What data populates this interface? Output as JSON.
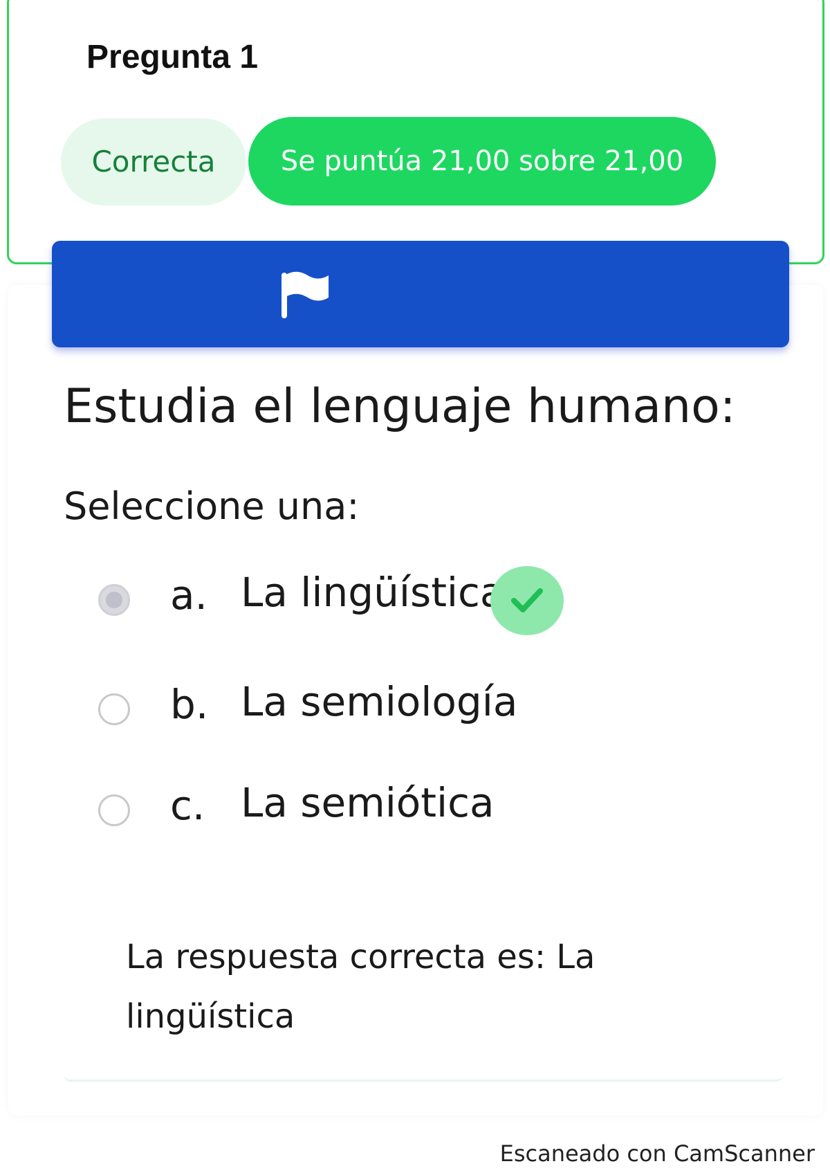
{
  "question": {
    "number_label": "Pregunta 1",
    "status_label": "Correcta",
    "score_label": "Se puntúa 21,00 sobre 21,00",
    "text": "Estudia el lenguaje humano:",
    "prompt": "Seleccione una:"
  },
  "options": [
    {
      "letter": "a.",
      "text": "La lingüística",
      "selected": true,
      "correct": true
    },
    {
      "letter": "b.",
      "text": "La semiología",
      "selected": false,
      "correct": false
    },
    {
      "letter": "c.",
      "text": "La semiótica",
      "selected": false,
      "correct": false
    }
  ],
  "feedback": {
    "correct_answer_text": "La respuesta correcta es: La lingüística"
  },
  "flag": {
    "icon": "flag-icon"
  },
  "footer": {
    "scanner_text": "Escaneado con CamScanner"
  },
  "colors": {
    "correct_green": "#1ed760",
    "correct_badge_bg": "#e6f8ec",
    "flag_bar_blue": "#1650c9",
    "check_bg": "#8ee8ac"
  }
}
